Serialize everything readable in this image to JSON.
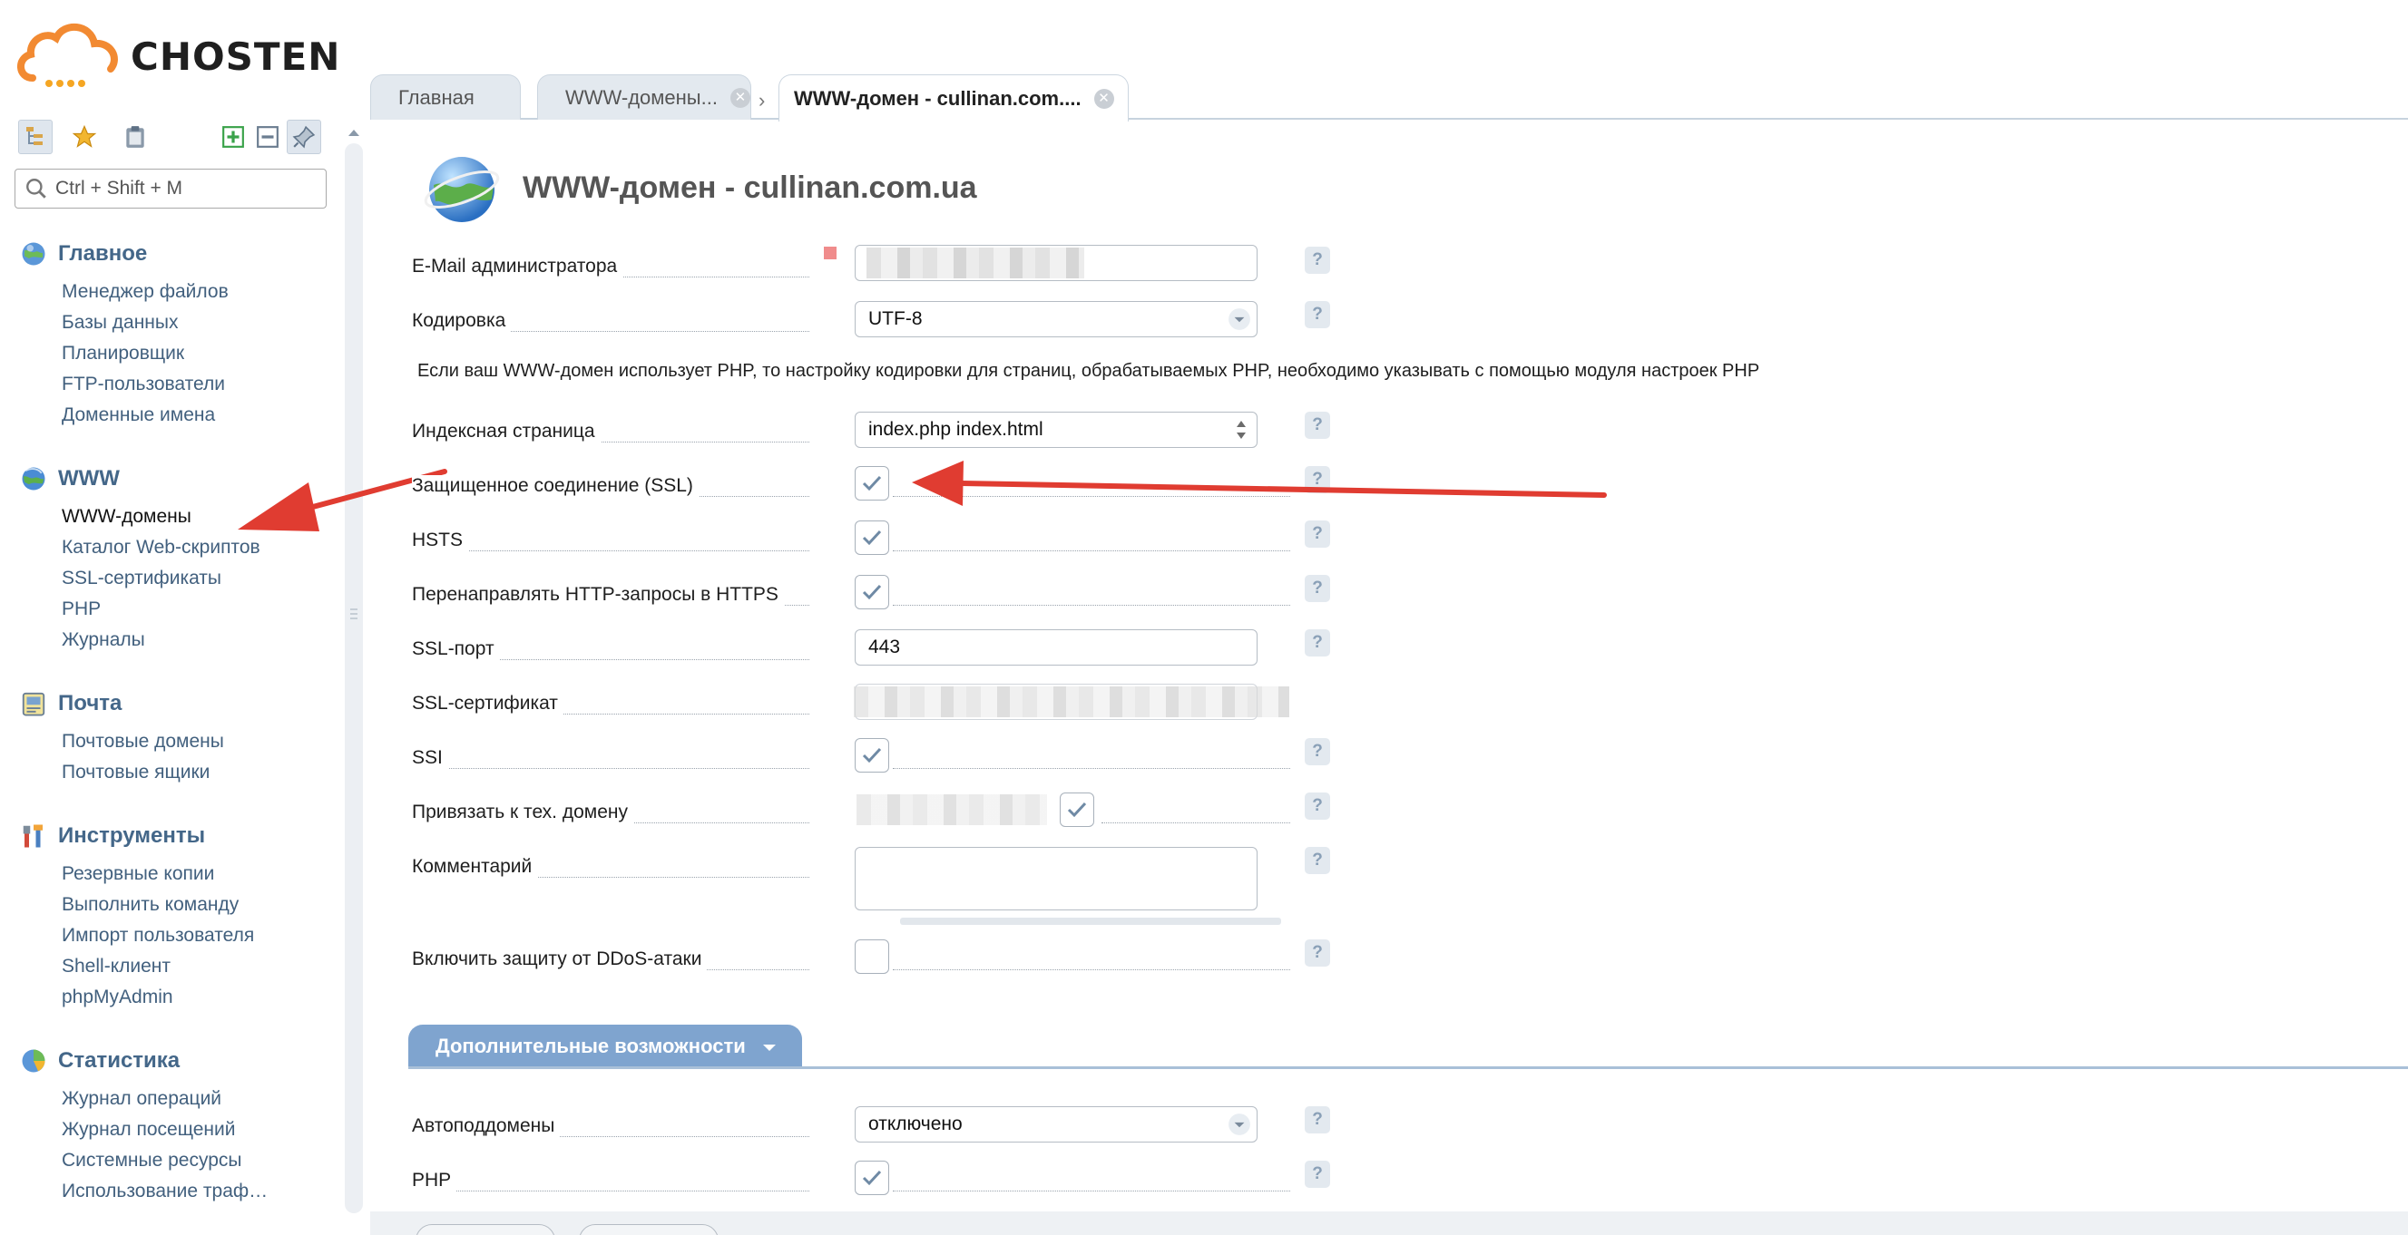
{
  "brand": {
    "name": "CHOSTEN"
  },
  "sidebar": {
    "search_placeholder": "Ctrl + Shift + M",
    "toolbar": [
      "tree-icon",
      "star-icon",
      "clipboard-icon",
      "expand-icon",
      "collapse-icon",
      "pin-icon"
    ],
    "groups": [
      {
        "title": "Главное",
        "icon": "globe-icon",
        "items": [
          "Менеджер файлов",
          "Базы данных",
          "Планировщик",
          "FTP-пользователи",
          "Доменные имена"
        ]
      },
      {
        "title": "WWW",
        "icon": "www-globe-icon",
        "items": [
          "WWW-домены",
          "Каталог Web-скриптов",
          "SSL-сертификаты",
          "PHP",
          "Журналы"
        ]
      },
      {
        "title": "Почта",
        "icon": "mail-icon",
        "items": [
          "Почтовые домены",
          "Почтовые ящики"
        ]
      },
      {
        "title": "Инструменты",
        "icon": "tools-icon",
        "items": [
          "Резервные копии",
          "Выполнить команду",
          "Импорт пользователя",
          "Shell-клиент",
          "phpMyAdmin"
        ]
      },
      {
        "title": "Статистика",
        "icon": "stats-icon",
        "items": [
          "Журнал операций",
          "Журнал посещений",
          "Системные ресурсы",
          "Использование траф…"
        ]
      }
    ]
  },
  "tabs": [
    {
      "label": "Главная"
    },
    {
      "label": "WWW-домены..."
    },
    {
      "label": "WWW-домен - cullinan.com...."
    }
  ],
  "page": {
    "title": "WWW-домен - cullinan.com.ua",
    "info": "Если ваш WWW-домен использует PHP, то настройку кодировки для страниц, обрабатываемых PHP, необходимо указывать с помощью модуля настроек PHP",
    "help_glyph": "?",
    "fields": {
      "email": {
        "label": "E-Mail администратора"
      },
      "encoding": {
        "label": "Кодировка",
        "value": "UTF-8"
      },
      "index": {
        "label": "Индексная страница",
        "value": "index.php index.html"
      },
      "ssl": {
        "label": "Защищенное соединение (SSL)",
        "checked": true
      },
      "hsts": {
        "label": "HSTS",
        "checked": true
      },
      "redirect": {
        "label": "Перенаправлять HTTP-запросы в HTTPS",
        "checked": true
      },
      "ssl_port": {
        "label": "SSL-порт",
        "value": "443"
      },
      "ssl_cert": {
        "label": "SSL-сертификат"
      },
      "ssi": {
        "label": "SSI",
        "checked": true
      },
      "bind": {
        "label": "Привязать к тех. домену",
        "checked": true
      },
      "comment": {
        "label": "Комментарий"
      },
      "ddos": {
        "label": "Включить защиту от DDoS-атаки",
        "checked": false
      }
    },
    "section": {
      "label": "Дополнительные возможности"
    },
    "extra": {
      "autosub": {
        "label": "Автоподдомены",
        "value": "отключено"
      },
      "php": {
        "label": "PHP",
        "checked": true
      }
    }
  },
  "colors": {
    "accent": "#446789",
    "annotation": "#e03c31",
    "section": "#7fa4cf"
  }
}
